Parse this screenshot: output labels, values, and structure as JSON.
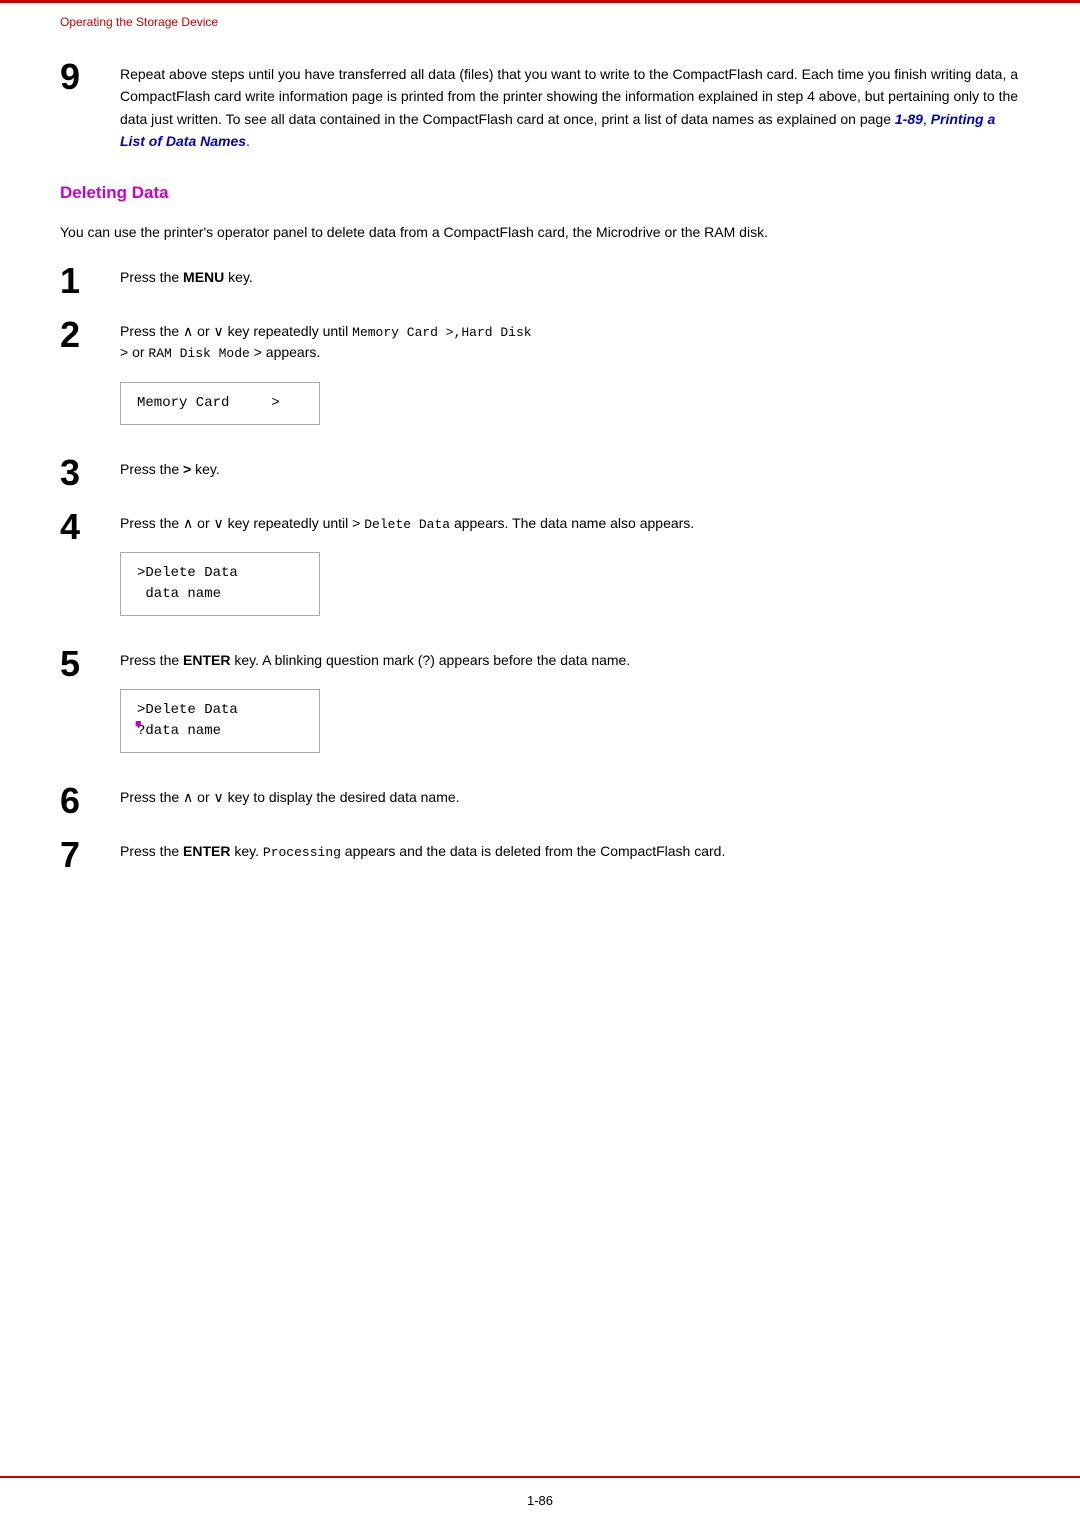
{
  "page": {
    "top_rule_color": "#cc0000",
    "header": {
      "breadcrumb": "Operating the Storage Device"
    },
    "step9": {
      "number": "9",
      "text": "Repeat above steps until you have transferred all data (files) that you want to write to the CompactFlash card. Each time you finish writing data, a CompactFlash card write information page is printed from the printer showing the information explained in step 4 above, but pertaining only to the data just written. To see all data contained in the CompactFlash card at once, print a list of data names as explained on page ",
      "page_ref": "1-89",
      "link_text": "Printing a List of Data Names",
      "text_end": "."
    },
    "section": {
      "heading": "Deleting Data"
    },
    "intro": "You can use the printer's operator panel to delete data from a CompactFlash card, the Microdrive or the RAM disk.",
    "steps": [
      {
        "number": "1",
        "text_before": "Press the ",
        "bold": "MENU",
        "text_after": " key.",
        "has_display": false
      },
      {
        "number": "2",
        "text_before": "Press the ∧ or ∨ key repeatedly until ",
        "code": "Memory Card >,Hard Disk",
        "text_mid": " > or ",
        "code2": "RAM Disk Mode",
        "text_after": " > appears.",
        "has_display": true,
        "display_lines": [
          "Memory Card     >"
        ]
      },
      {
        "number": "3",
        "text_before": "Press the ",
        "bold": ">",
        "text_after": " key.",
        "has_display": false
      },
      {
        "number": "4",
        "text_before": "Press the ∧ or ∨ key repeatedly until > ",
        "code": "Delete Data",
        "text_after": " appears. The data name also appears.",
        "has_display": true,
        "display_lines": [
          ">Delete Data",
          " data name"
        ]
      },
      {
        "number": "5",
        "text_before": "Press the ",
        "bold": "ENTER",
        "text_after": " key. A blinking question mark (?) appears before the data name.",
        "has_display": true,
        "display_lines": [
          ">Delete Data",
          "?data name"
        ],
        "has_cursor": true
      },
      {
        "number": "6",
        "text_before": "Press the ∧ or ∨ key to display the desired data name.",
        "has_display": false
      },
      {
        "number": "7",
        "text_before": "Press the ",
        "bold": "ENTER",
        "text_mid": " key. ",
        "code": "Processing",
        "text_after": " appears and the data is deleted from the CompactFlash card.",
        "has_display": false
      }
    ],
    "footer": {
      "page_number": "1-86"
    }
  }
}
